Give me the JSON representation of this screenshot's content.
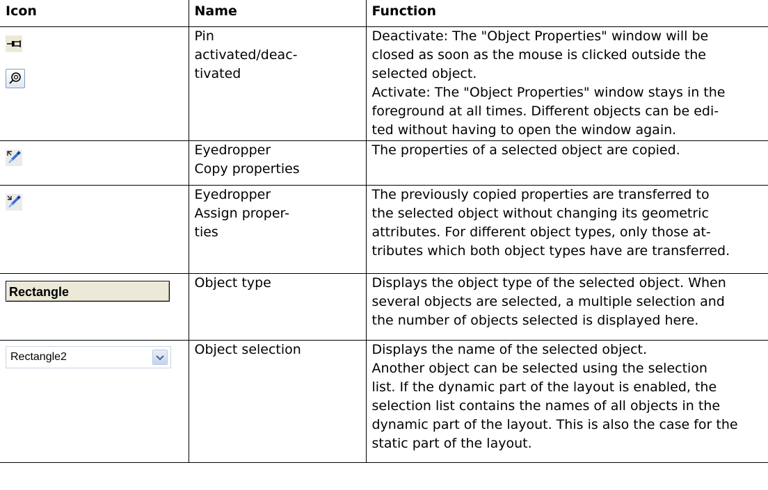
{
  "table": {
    "headers": [
      "Icon",
      "Name",
      "Function"
    ],
    "rows": [
      {
        "icon_names": [
          "pin-deactivated-icon",
          "pin-activated-icon"
        ],
        "name_lines": [
          "Pin",
          "activated/deac-",
          "tivated"
        ],
        "function_lines": [
          "Deactivate: The \"Object Properties\" window will be",
          "closed as soon as the mouse is clicked outside the",
          "selected object.",
          "Activate: The \"Object Properties\" window stays in the",
          "foreground at all times. Different objects can be edi-",
          "ted without having to open the window again."
        ]
      },
      {
        "icon_names": [
          "eyedropper-copy-icon"
        ],
        "name_lines": [
          "Eyedropper",
          "Copy properties"
        ],
        "function_lines": [
          "The properties of a selected object are copied."
        ]
      },
      {
        "icon_names": [
          "eyedropper-assign-icon"
        ],
        "name_lines": [
          "Eyedropper",
          "Assign proper-",
          "ties"
        ],
        "function_lines": [
          "The previously copied properties are transferred to",
          "the selected object without changing its geometric",
          "attributes. For different object types, only those at-",
          "tributes which both object types have are transferred."
        ]
      },
      {
        "icon_names": [
          "object-type-field"
        ],
        "icon_text": "Rectangle",
        "name_lines": [
          "Object type"
        ],
        "function_lines": [
          "Displays the object type of the selected object. When",
          "several objects are selected, a multiple selection and",
          "the number of objects selected is displayed here."
        ]
      },
      {
        "icon_names": [
          "object-selection-dropdown"
        ],
        "icon_text": "Rectangle2",
        "name_lines": [
          "Object selection"
        ],
        "function_lines": [
          "Displays the name of the selected object.",
          "Another object can be selected using the selection",
          "list. If the dynamic part of the layout is enabled, the",
          "selection list contains the names of all objects in the",
          "dynamic part of the layout. This is also the case for the",
          "static part of the layout."
        ]
      }
    ]
  }
}
